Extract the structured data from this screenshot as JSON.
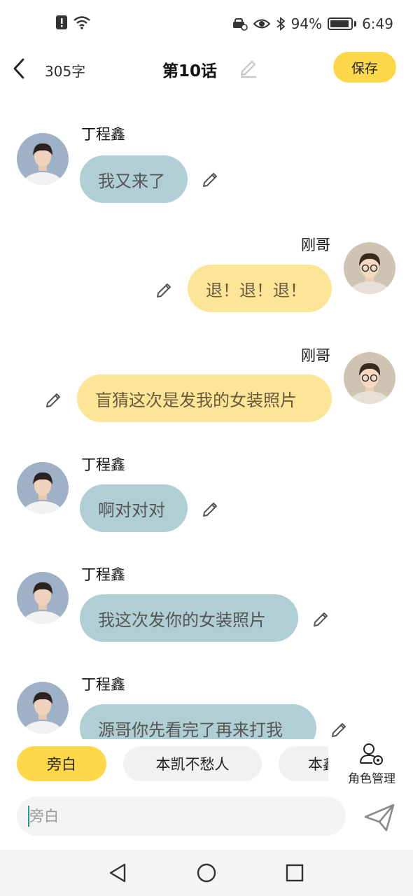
{
  "status_bar": {
    "battery": "94%",
    "time": "6:49"
  },
  "header": {
    "word_count": "305字",
    "title": "第10话",
    "save_label": "保存"
  },
  "messages": [
    {
      "side": "left",
      "sender": "丁程鑫",
      "text": "我又来了"
    },
    {
      "side": "right",
      "sender": "刚哥",
      "text": "退！退！退！"
    },
    {
      "side": "right",
      "sender": "刚哥",
      "text": "盲猜这次是发我的女装照片"
    },
    {
      "side": "left",
      "sender": "丁程鑫",
      "text": "啊对对对"
    },
    {
      "side": "left",
      "sender": "丁程鑫",
      "text": "我这次发你的女装照片"
    },
    {
      "side": "left",
      "sender": "丁程鑫",
      "text": "源哥你先看完了再来打我"
    }
  ],
  "roles": {
    "chips": [
      "旁白",
      "本凯不愁人",
      "本鑫"
    ],
    "active_index": 0,
    "manage_label": "角色管理"
  },
  "composer": {
    "placeholder": "旁白"
  },
  "colors": {
    "accent_yellow": "#FDD94A",
    "bubble_left": "#AFCFD5",
    "bubble_right": "#FDE597"
  }
}
